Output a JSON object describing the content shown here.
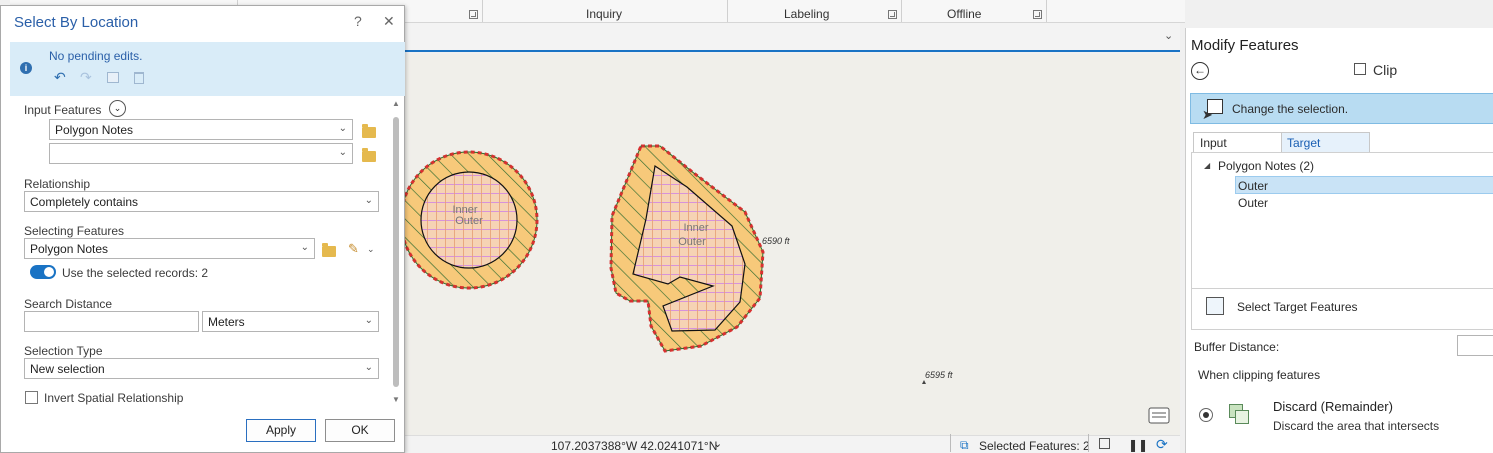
{
  "ribbon": {
    "groups": [
      "Inquiry",
      "Labeling",
      "Offline"
    ]
  },
  "dialog": {
    "title": "Select By Location",
    "help_glyph": "?",
    "close_glyph": "✕",
    "edits_status": "No pending edits.",
    "input_features_label": "Input Features",
    "input_feature_1": "Polygon Notes",
    "input_feature_2": "",
    "relationship_label": "Relationship",
    "relationship_value": "Completely contains",
    "selecting_features_label": "Selecting Features",
    "selecting_features_value": "Polygon Notes",
    "use_selected_label": "Use the selected records: 2",
    "search_distance_label": "Search Distance",
    "search_distance_value": "",
    "distance_unit": "Meters",
    "selection_type_label": "Selection Type",
    "selection_type_value": "New selection",
    "invert_label": "Invert Spatial Relationship",
    "apply_label": "Apply",
    "ok_label": "OK"
  },
  "map": {
    "circle_label_inner": "Inner",
    "circle_label_outer": "Outer",
    "poly_label_inner": "Inner",
    "poly_label_outer": "Outer",
    "contour_1": "6590 ft",
    "contour_2": "6595 ft",
    "colors": {
      "buffer_fill": "#f7c97a",
      "hatch_green": "#2f6b2f",
      "inner_fill": "#f3c8d4",
      "crosshatch": "#d48be0",
      "dashed_outline": "#d93030"
    }
  },
  "status": {
    "coordinates": "107.2037388°W 42.0241071°N",
    "selected_features": "Selected Features: 2"
  },
  "modify": {
    "pane_title": "Modify Features",
    "tool_name": "Clip",
    "instruction": "Change the selection.",
    "tabs": [
      "Input Features",
      "Target Features"
    ],
    "tree_group": "Polygon Notes (2)",
    "tree_items": [
      "Outer",
      "Outer"
    ],
    "select_target_label": "Select Target Features",
    "buffer_distance_label": "Buffer Distance:",
    "when_clipping_label": "When clipping features",
    "option_title": "Discard (Remainder)",
    "option_desc": "Discard the area that intersects"
  }
}
